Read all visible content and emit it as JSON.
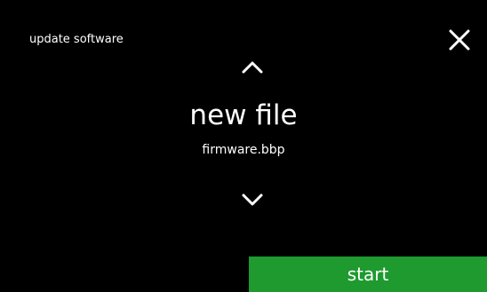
{
  "header": {
    "title": "update software",
    "close_icon": "close-icon"
  },
  "selector": {
    "up_icon": "chevron-up-icon",
    "down_icon": "chevron-down-icon",
    "item_title": "new file",
    "item_subtitle": "firmware.bbp"
  },
  "footer": {
    "start_label": "start"
  },
  "colors": {
    "background": "#000000",
    "text": "#ffffff",
    "accent_green": "#1e9a2f"
  }
}
